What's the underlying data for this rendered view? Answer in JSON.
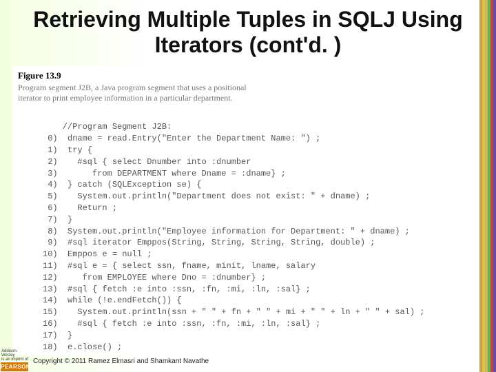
{
  "title": "Retrieving Multiple Tuples in SQLJ Using Iterators (cont'd. )",
  "figure": {
    "label": "Figure 13.9",
    "caption_l1": "Program segment J2B, a Java program segment that uses a positional",
    "caption_l2": "iterator to print employee information in a particular department."
  },
  "code": {
    "comment": "    //Program Segment J2B:",
    "lines": [
      " 0)  dname = read.Entry(\"Enter the Department Name: \") ;",
      " 1)  try {",
      " 2)    #sql { select Dnumber into :dnumber",
      " 3)       from DEPARTMENT where Dname = :dname} ;",
      " 4)  } catch (SQLException se) {",
      " 5)    System.out.println(\"Department does not exist: \" + dname) ;",
      " 6)    Return ;",
      " 7)  }",
      " 8)  System.out.println(\"Employee information for Department: \" + dname) ;",
      " 9)  #sql iterator Emppos(String, String, String, String, double) ;",
      "10)  Emppos e = null ;",
      "11)  #sql e = { select ssn, fname, minit, lname, salary",
      "12)     from EMPLOYEE where Dno = :dnumber} ;",
      "13)  #sql { fetch :e into :ssn, :fn, :mi, :ln, :sal} ;",
      "14)  while (!e.endFetch()) {",
      "15)    System.out.println(ssn + \" \" + fn + \" \" + mi + \" \" + ln + \" \" + sal) ;",
      "16)    #sql { fetch :e into :ssn, :fn, :mi, :ln, :sal} ;",
      "17)  }",
      "18)  e.close() ;"
    ]
  },
  "footer": {
    "publisher_small_l1": "Addison-Wesley",
    "publisher_small_l2": "is an imprint of",
    "publisher_logo": "PEARSON",
    "copyright": "Copyright © 2011 Ramez Elmasri and Shamkant Navathe"
  }
}
